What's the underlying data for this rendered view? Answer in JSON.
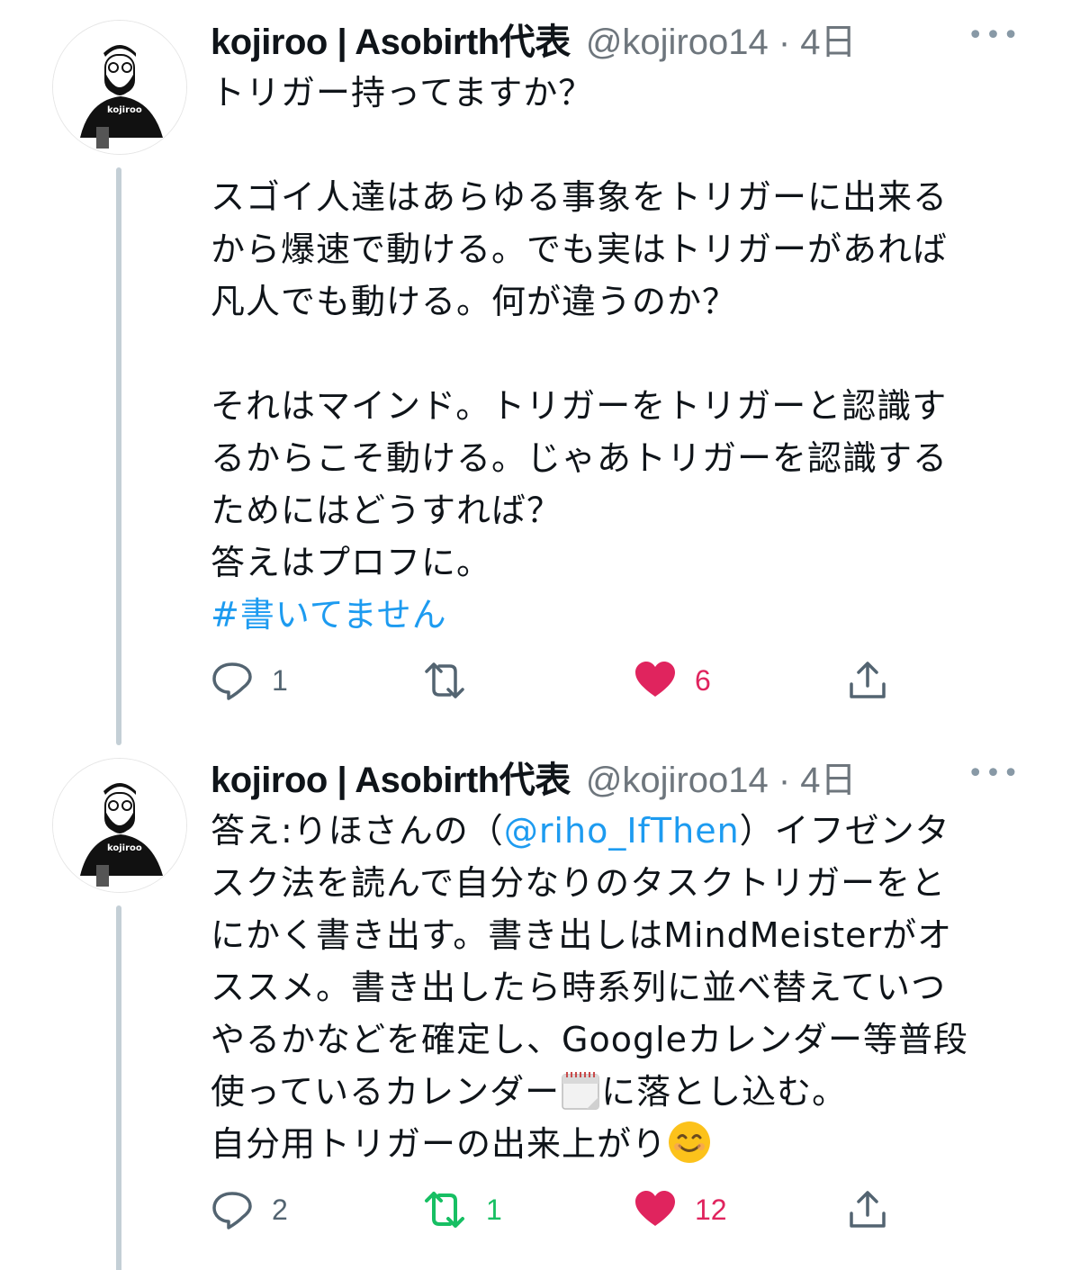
{
  "tweets": [
    {
      "display_name": "kojiroo | Asobirth代表",
      "handle": "@kojiroo14 · 4日",
      "more": "•••",
      "avatar_text": "kojiroo",
      "body": "トリガー持ってますか？\n\nスゴイ人達はあらゆる事象をトリガーに出来る\nから爆速で動ける。でも実はトリガーがあれば\n凡人でも動ける。何が違うのか？\n\nそれはマインド。トリガーをトリガーと認識す\nるからこそ動ける。じゃあトリガーを認識する\nためにはどうすれば？\n答えはプロフに。",
      "hashtag": "#書いてません",
      "replies": "1",
      "retweets": "",
      "likes": "6"
    },
    {
      "display_name": "kojiroo | Asobirth代表",
      "handle": "@kojiroo14 · 4日",
      "more": "•••",
      "avatar_text": "kojiroo",
      "body_prefix": "答え:りほさんの（",
      "mention": "@riho_IfThen",
      "body_mid": "）イフゼンタ\nスク法を読んで自分なりのタスクトリガーをと\nにかく書き出す。書き出しはMindMeisterがオ\nススメ。書き出したら時系列に並べ替えていつ\nやるかなどを確定し、Googleカレンダー等普段\n使っているカレンダー",
      "body_after_cal": "に落とし込む。\n自分用トリガーの出来上がり",
      "replies": "2",
      "retweets": "1",
      "likes": "12"
    }
  ],
  "icons": {
    "reply": "speech-bubble-icon",
    "retweet": "retweet-arrows-icon",
    "like": "heart-icon",
    "share": "share-upload-icon",
    "calendar": "calendar-emoji-icon",
    "smile": "smiling-face-emoji-icon"
  },
  "colors": {
    "link": "#1d9bf0",
    "like": "#e0245e",
    "retweet": "#17bf63",
    "muted": "#6e767d"
  }
}
